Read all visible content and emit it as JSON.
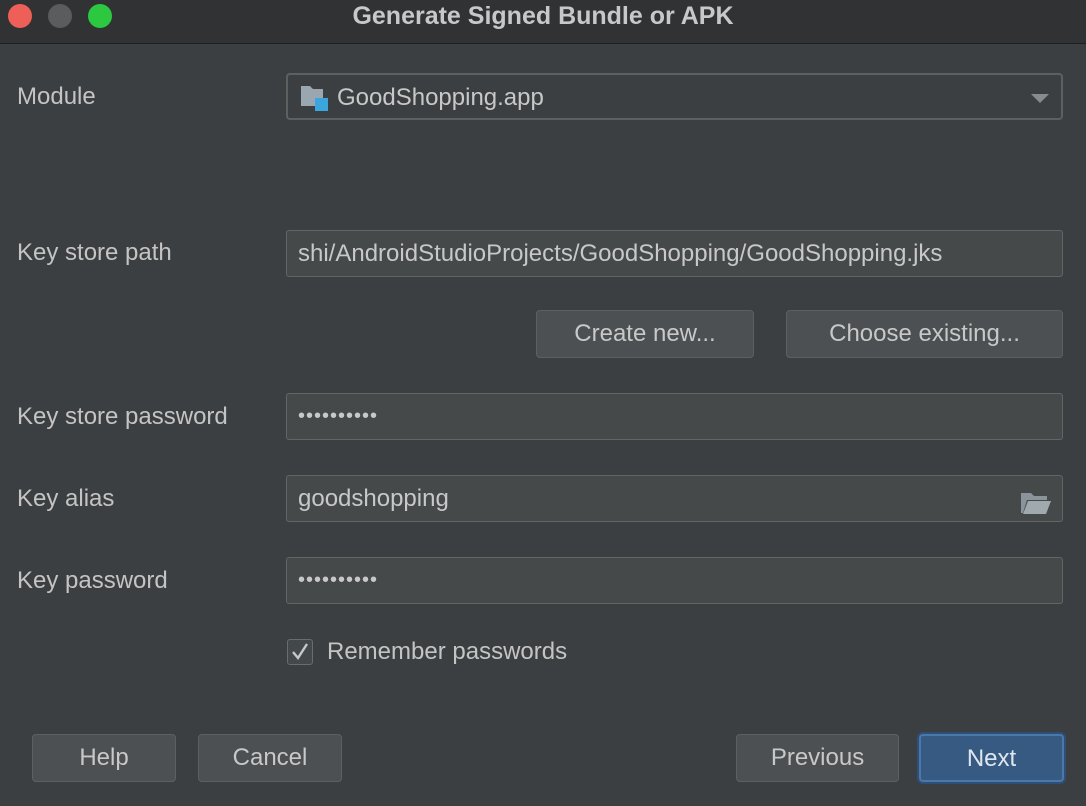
{
  "window": {
    "title": "Generate Signed Bundle or APK"
  },
  "form": {
    "module": {
      "label": "Module",
      "value": "GoodShopping.app"
    },
    "key_store_path": {
      "label": "Key store path",
      "value": "shi/AndroidStudioProjects/GoodShopping/GoodShopping.jks"
    },
    "create_new_label": "Create new...",
    "choose_existing_label": "Choose existing...",
    "key_store_password": {
      "label": "Key store password",
      "value": "••••••••••"
    },
    "key_alias": {
      "label": "Key alias",
      "value": "goodshopping"
    },
    "key_password": {
      "label": "Key password",
      "value": "••••••••••"
    },
    "remember_passwords": {
      "label": "Remember passwords",
      "checked": true
    }
  },
  "footer": {
    "help_label": "Help",
    "cancel_label": "Cancel",
    "previous_label": "Previous",
    "next_label": "Next"
  },
  "colors": {
    "background": "#3c3f41",
    "accent": "#375a83",
    "module_icon_badge": "#3ba6dd"
  },
  "icons": {
    "module": "module-folder-icon",
    "browse": "open-folder-icon",
    "check": "checkmark-icon"
  }
}
